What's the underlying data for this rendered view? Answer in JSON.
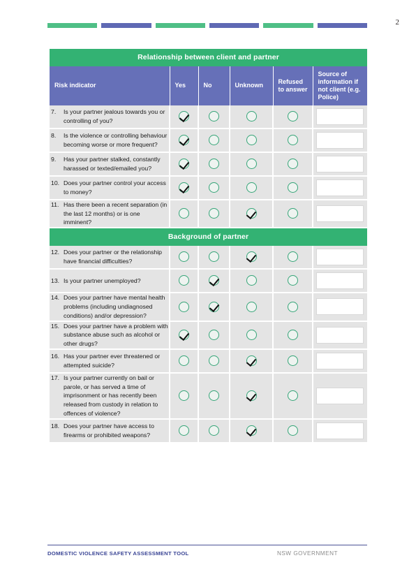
{
  "page": {
    "number": "2",
    "decor_bars": [
      {
        "color": "#4fbf86"
      },
      {
        "color": "#5f69b4"
      },
      {
        "color": "#4fbf86"
      },
      {
        "color": "#5f69b4"
      },
      {
        "color": "#4fbf86"
      },
      {
        "color": "#5f69b4"
      }
    ],
    "accent_green": "#33b273",
    "accent_blue": "#6670b8",
    "row_bg": "#e4e4e4"
  },
  "table": {
    "column_headers": {
      "risk_indicator": "Risk indicator",
      "yes": "Yes",
      "no": "No",
      "unknown": "Unknown",
      "refused": "Refused to answer",
      "source": "Source of information if not client (e.g. Police)"
    },
    "sections": [
      {
        "title": "Relationship between client and partner",
        "rows": [
          {
            "number": "7.",
            "question": "Is your partner jealous towards you or controlling of you?",
            "answer": "yes",
            "source": ""
          },
          {
            "number": "8.",
            "question": "Is the violence or controlling behaviour becoming worse or more frequent?",
            "answer": "yes",
            "source": ""
          },
          {
            "number": "9.",
            "question": "Has your partner stalked, constantly harassed or texted/emailed you?",
            "answer": "yes",
            "source": ""
          },
          {
            "number": "10.",
            "question": "Does your partner control your access to money?",
            "answer": "yes",
            "source": ""
          },
          {
            "number": "11.",
            "question": "Has there been a recent separation (in the last 12 months) or is one imminent?",
            "answer": "unknown",
            "source": ""
          }
        ]
      },
      {
        "title": "Background of partner",
        "rows": [
          {
            "number": "12.",
            "question": "Does your partner or the relationship have financial difficulties?",
            "answer": "unknown",
            "source": ""
          },
          {
            "number": "13.",
            "question": "Is your partner unemployed?",
            "answer": "no",
            "source": ""
          },
          {
            "number": "14.",
            "question": "Does your partner have mental health problems (including undiagnosed conditions) and/or depression?",
            "answer": "no",
            "source": ""
          },
          {
            "number": "15.",
            "question": "Does your partner have a problem with substance abuse such as alcohol or other drugs?",
            "answer": "yes",
            "source": ""
          },
          {
            "number": "16.",
            "question": "Has your partner ever threatened or attempted suicide?",
            "answer": "unknown",
            "source": ""
          },
          {
            "number": "17.",
            "question": "Is your partner currently on bail or parole, or has served a time of imprisonment or has recently been released from custody in relation to offences of violence?",
            "answer": "unknown",
            "source": ""
          },
          {
            "number": "18.",
            "question": "Does your partner have access to firearms or prohibited weapons?",
            "answer": "unknown",
            "source": ""
          }
        ]
      }
    ]
  },
  "footer": {
    "left": "DOMESTIC VIOLENCE SAFETY ASSESSMENT TOOL",
    "right": "NSW GOVERNMENT"
  }
}
